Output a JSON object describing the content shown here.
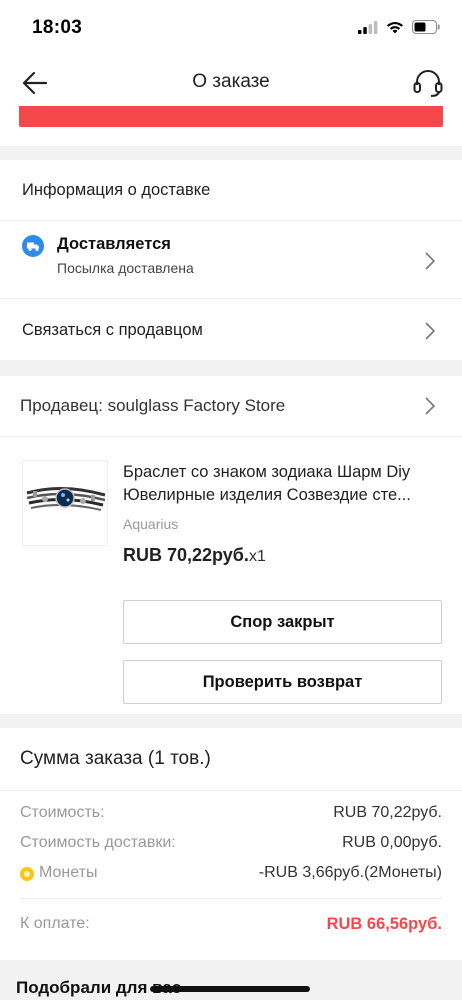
{
  "status_bar": {
    "time": "18:03"
  },
  "header": {
    "title": "О заказе",
    "back_icon": "arrow-left-icon",
    "support_icon": "headset-icon"
  },
  "colors": {
    "accent_red": "#f4484a",
    "delivery_blue": "#2f8be8",
    "coin_yellow": "#f6c41a"
  },
  "delivery": {
    "section_title": "Информация о доставке",
    "status_title": "Доставляется",
    "status_subtitle": "Посылка доставлена",
    "contact_seller": "Связаться с продавцом"
  },
  "seller": {
    "label": "Продавец: soulglass Factory Store"
  },
  "product": {
    "title_line1": "Браслет со знаком зодиака Шарм Diy",
    "title_line2": "Ювелирные изделия Созвездие сте...",
    "variant": "Aquarius",
    "price": "RUB 70,22руб.",
    "quantity": "x1",
    "btn_dispute": "Спор закрыт",
    "btn_return": "Проверить возврат"
  },
  "summary": {
    "title": "Сумма заказа (1 тов.)",
    "cost_label": "Стоимость:",
    "cost_value": "RUB 70,22руб.",
    "shipping_label": "Стоимость доставки:",
    "shipping_value": "RUB 0,00руб.",
    "coins_label": "Монеты",
    "coins_value": "-RUB 3,66руб.(2Монеты)",
    "total_label": "К оплате:",
    "total_value": "RUB 66,56руб."
  },
  "recommendations": {
    "title": "Подобрали для вас"
  }
}
